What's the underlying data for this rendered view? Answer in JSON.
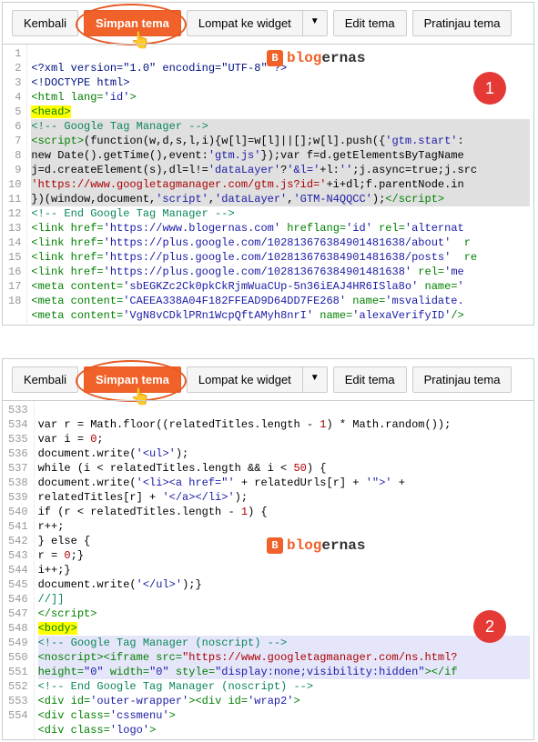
{
  "toolbar": {
    "back": "Kembali",
    "save": "Simpan tema",
    "jump": "Lompat ke widget",
    "edit": "Edit tema",
    "preview": "Pratinjau tema"
  },
  "brand": {
    "icon": "B",
    "name_pre": "blog",
    "name_post": "ernas"
  },
  "badge1": "1",
  "badge2": "2",
  "p1": {
    "nums": [
      "1",
      "2",
      "3",
      "4",
      "5",
      "6",
      "7",
      "8",
      "9",
      "10",
      "11",
      "12",
      "13",
      "14",
      "15",
      "16",
      "17",
      "18"
    ],
    "l1": "<?xml version=\"1.0\" encoding=\"UTF-8\" ?>",
    "l2": "<!DOCTYPE html>",
    "l3a": "<html",
    "l3b": " lang=",
    "l3c": "'id'",
    "l3d": ">",
    "l4": "<head>",
    "l5": "<!-- Google Tag Manager -->",
    "l6a": "<script>",
    "l6b": "(function(w,d,s,l,i){w[l]=w[l]||[];w[l].push({",
    "l6c": "'gtm.start'",
    "l6d": ":",
    "l7a": "new Date().getTime(),event:",
    "l7b": "'gtm.js'",
    "l7c": "});var f=d.getElementsByTagName",
    "l8a": "j=d.createElement(s),dl=l!=",
    "l8b": "'dataLayer'",
    "l8c": "?",
    "l8d": "'&l='",
    "l8e": "+l:",
    "l8f": "''",
    "l8g": ";j.async=true;j.src",
    "l9a": "'https://www.googletagmanager.com/gtm.js?id='",
    "l9b": "+i+dl;f.parentNode.in",
    "l10a": "})(window,document,",
    "l10b": "'script'",
    "l10c": ",",
    "l10d": "'dataLayer'",
    "l10e": ",",
    "l10f": "'GTM-N4QQCC'",
    "l10g": ");",
    "l10h": "</script>",
    "l11": "<!-- End Google Tag Manager -->",
    "l12a": "<link",
    "l12b": " href=",
    "l12c": "'https://www.blogernas.com'",
    "l12d": " hreflang=",
    "l12e": "'id'",
    "l12f": " rel=",
    "l12g": "'alternat",
    "l13a": "<link",
    "l13b": " href=",
    "l13c": "'https://plus.google.com/102813676384901481638/about'",
    "l13d": "  r",
    "l14a": "<link",
    "l14b": " href=",
    "l14c": "'https://plus.google.com/102813676384901481638/posts'",
    "l14d": "  re",
    "l15a": "<link",
    "l15b": " href=",
    "l15c": "'https://plus.google.com/102813676384901481638'",
    "l15d": " rel=",
    "l15e": "'me",
    "l16a": "<meta",
    "l16b": " content=",
    "l16c": "'sbEGKZc2Ck0pkCkRjmWuaCUp-5n36iEAJ4HR6ISla8o'",
    "l16d": " name=",
    "l16e": "'",
    "l17a": "<meta",
    "l17b": " content=",
    "l17c": "'CAEEA338A04F182FFEAD9D64DD7FE268'",
    "l17d": " name=",
    "l17e": "'msvalidate.",
    "l18a": "<meta",
    "l18b": " content=",
    "l18c": "'VgN8vCDklPRn1WcpQftAMyh8nrI'",
    "l18d": " name=",
    "l18e": "'alexaVerifyID'",
    "l18f": "/>"
  },
  "p2": {
    "nums": [
      "533",
      "534",
      "535",
      "536",
      "537",
      "538",
      "539",
      "540",
      "541",
      "542",
      "543",
      "544",
      "545",
      "546",
      "547",
      "548",
      "549",
      "550",
      "551",
      "552",
      "553",
      "554"
    ],
    "l533a": "var r = Math.floor((relatedTitles.length - ",
    "l533b": "1",
    "l533c": ") * Math.random());",
    "l534a": "var i = ",
    "l534b": "0",
    "l534c": ";",
    "l535a": "document.write(",
    "l535b": "'<ul>'",
    "l535c": ");",
    "l536a": "while (i < relatedTitles.length && i < ",
    "l536b": "50",
    "l536c": ") {",
    "l537a": "document.write(",
    "l537b": "'<li><a href=\"'",
    "l537c": " + relatedUrls[r] + ",
    "l537d": "'\">'",
    "l537e": " + ",
    "l538a": "relatedTitles[r] + ",
    "l538b": "'</a></li>'",
    "l538c": ");",
    "l539a": "if (r < relatedTitles.length - ",
    "l539b": "1",
    "l539c": ") {",
    "l540": "r++;",
    "l541": "} else {",
    "l542a": "r = ",
    "l542b": "0",
    "l542c": ";}",
    "l543": "i++;}",
    "l544a": "document.write(",
    "l544b": "'</ul>'",
    "l544c": ");}",
    "l545": "//]]",
    "l546": "</script>",
    "l547": "<body>",
    "l548": "<!-- Google Tag Manager (noscript) -->",
    "l549a": "<noscript>",
    "l549b": "<iframe",
    "l549c": " src=",
    "l549d": "\"https://www.googletagmanager.com/ns.html?",
    "l550a": "height=",
    "l550b": "\"0\"",
    "l550c": " width=",
    "l550d": "\"0\"",
    "l550e": " style=",
    "l550f": "\"display:none;visibility:hidden\"",
    "l550g": "></if",
    "l551": "<!-- End Google Tag Manager (noscript) -->",
    "l552a": "<div",
    "l552b": " id=",
    "l552c": "'outer-wrapper'",
    "l552d": "><div",
    "l552e": " id=",
    "l552f": "'wrap2'",
    "l552g": ">",
    "l553a": "<div",
    "l553b": " class=",
    "l553c": "'cssmenu'",
    "l553d": ">",
    "l554a": "<div",
    "l554b": " class=",
    "l554c": "'logo'",
    "l554d": ">"
  }
}
